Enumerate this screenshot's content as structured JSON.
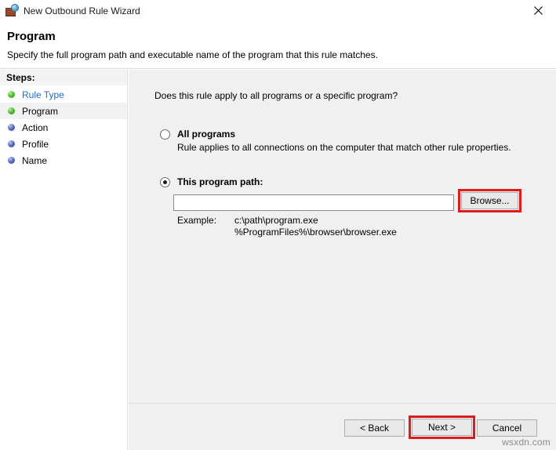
{
  "window": {
    "title": "New Outbound Rule Wizard",
    "icon": "firewall-globe-icon",
    "close_label": "✕"
  },
  "header": {
    "title": "Program",
    "subtitle": "Specify the full program path and executable name of the program that this rule matches."
  },
  "sidebar": {
    "heading": "Steps:",
    "items": [
      {
        "label": "Rule Type",
        "bullet": "green",
        "state": "completed-link"
      },
      {
        "label": "Program",
        "bullet": "green",
        "state": "current"
      },
      {
        "label": "Action",
        "bullet": "blue",
        "state": "pending"
      },
      {
        "label": "Profile",
        "bullet": "blue",
        "state": "pending"
      },
      {
        "label": "Name",
        "bullet": "blue",
        "state": "pending"
      }
    ]
  },
  "main": {
    "question": "Does this rule apply to all programs or a specific program?",
    "options": {
      "all_programs": {
        "label": "All programs",
        "description": "Rule applies to all connections on the computer that match other rule properties.",
        "selected": false
      },
      "this_program_path": {
        "label": "This program path:",
        "selected": true,
        "input_value": "",
        "input_placeholder": "",
        "browse_label": "Browse..."
      }
    },
    "example": {
      "label": "Example:",
      "line1": "c:\\path\\program.exe",
      "line2": "%ProgramFiles%\\browser\\browser.exe"
    }
  },
  "footer": {
    "back_label": "< Back",
    "next_label": "Next >",
    "cancel_label": "Cancel"
  },
  "watermark": "wsxdn.com",
  "colors": {
    "highlight_red": "#e01b1b",
    "link_blue": "#1d6fc4",
    "panel_gray": "#f0f0f0",
    "step_green": "#55c13a",
    "step_blue": "#6070c0"
  }
}
